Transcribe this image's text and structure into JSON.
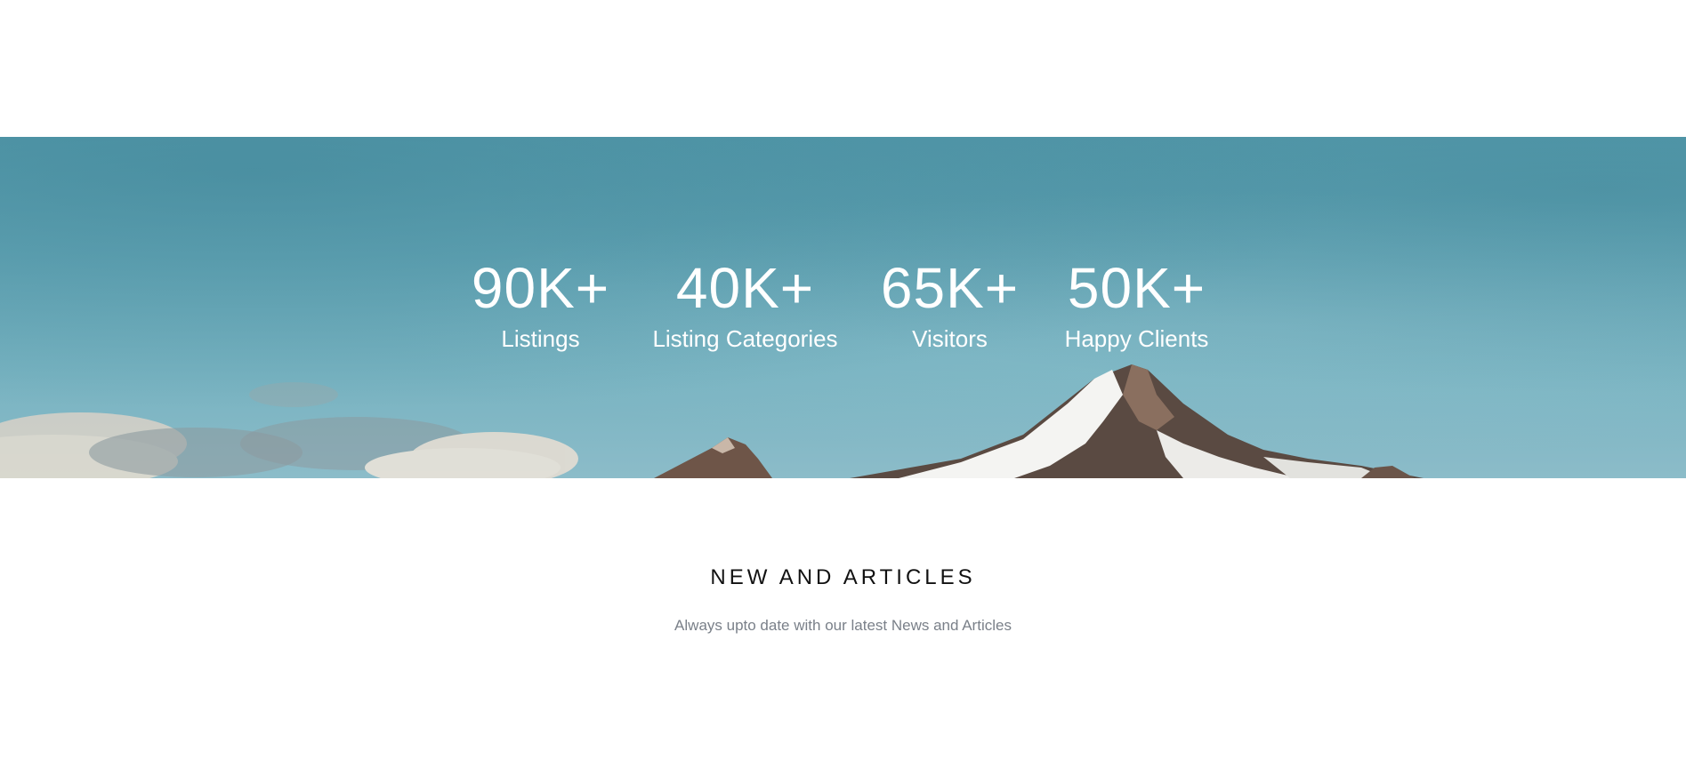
{
  "stats": [
    {
      "value": "90K+",
      "label": "Listings"
    },
    {
      "value": "40K+",
      "label": "Listing Categories"
    },
    {
      "value": "65K+",
      "label": "Visitors"
    },
    {
      "value": "50K+",
      "label": "Happy Clients"
    }
  ],
  "articles": {
    "title": "NEW AND ARTICLES",
    "subtitle": "Always upto date with our latest News and Articles"
  },
  "colors": {
    "sky": "#66a8b8",
    "text_light": "#ffffff",
    "title": "#111111",
    "subtitle": "#7a8089"
  }
}
